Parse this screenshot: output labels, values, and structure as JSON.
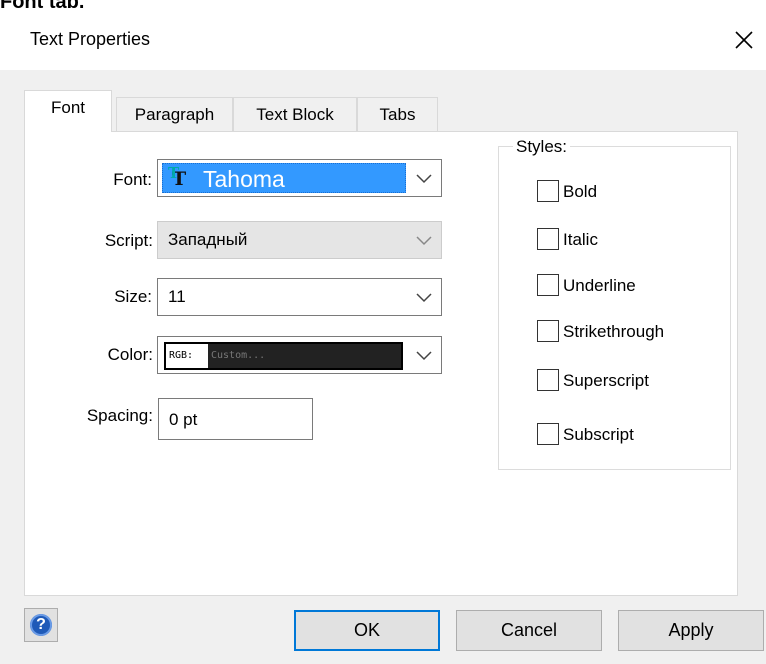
{
  "caption": "Font tab.",
  "dialog": {
    "title": "Text Properties",
    "close_icon": "close-icon"
  },
  "tabs": [
    {
      "label": "Font",
      "active": true
    },
    {
      "label": "Paragraph",
      "active": false
    },
    {
      "label": "Text Block",
      "active": false
    },
    {
      "label": "Tabs",
      "active": false
    }
  ],
  "fields": {
    "font_label": "Font:",
    "font_value": "Tahoma",
    "font_icon": "truetype-font-icon",
    "script_label": "Script:",
    "script_value": "Западный",
    "size_label": "Size:",
    "size_value": "11",
    "color_label": "Color:",
    "color_rgb": "RGB:",
    "color_value": "Custom...",
    "spacing_label": "Spacing:",
    "spacing_value": "0 pt"
  },
  "styles": {
    "title": "Styles:",
    "items": [
      {
        "label": "Bold",
        "checked": false
      },
      {
        "label": "Italic",
        "checked": false
      },
      {
        "label": "Underline",
        "checked": false
      },
      {
        "label": "Strikethrough",
        "checked": false
      },
      {
        "label": "Superscript",
        "checked": false
      },
      {
        "label": "Subscript",
        "checked": false
      }
    ]
  },
  "footer": {
    "help_icon": "help-icon",
    "help_glyph": "?",
    "ok_label": "OK",
    "cancel_label": "Cancel",
    "apply_label": "Apply"
  },
  "colors": {
    "selection": "#3399ff",
    "dialog_bg": "#f0f0f0",
    "default_button_border": "#0078d7"
  }
}
